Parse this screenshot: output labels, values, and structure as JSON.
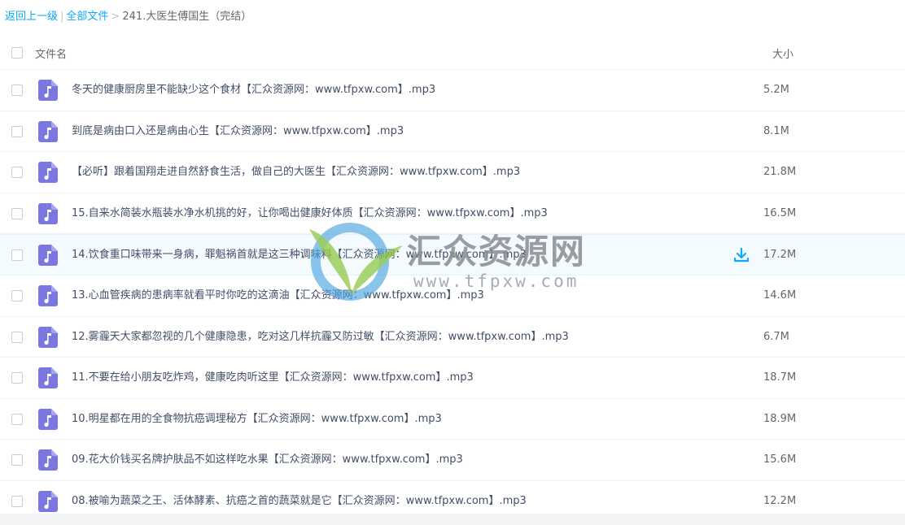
{
  "breadcrumb": {
    "back": "返回上一级",
    "separator": "|",
    "all_files": "全部文件",
    "arrow": ">",
    "current": "241.大医生傅国生（完结）"
  },
  "header": {
    "name_label": "文件名",
    "size_label": "大小"
  },
  "files": [
    {
      "name": "冬天的健康厨房里不能缺少这个食材【汇众资源网：www.tfpxw.com】.mp3",
      "size": "5.2M"
    },
    {
      "name": "到底是病由口入还是病由心生【汇众资源网：www.tfpxw.com】.mp3",
      "size": "8.1M"
    },
    {
      "name": "【必听】跟着国翔走进自然舒食生活，做自己的大医生【汇众资源网：www.tfpxw.com】.mp3",
      "size": "21.8M"
    },
    {
      "name": "15.自来水简装水瓶装水净水机挑的好，让你喝出健康好体质【汇众资源网：www.tfpxw.com】.mp3",
      "size": "16.5M"
    },
    {
      "name": "14.饮食重口味带来一身病，罪魁祸首就是这三种调味料【汇众资源网：www.tfpxw.com】.mp3",
      "size": "17.2M"
    },
    {
      "name": "13.心血管疾病的患病率就看平时你吃的这滴油【汇众资源网：www.tfpxw.com】.mp3",
      "size": "14.6M"
    },
    {
      "name": "12.雾霾天大家都忽视的几个健康隐患，吃对这几样抗霾又防过敏【汇众资源网：www.tfpxw.com】.mp3",
      "size": "6.7M"
    },
    {
      "name": "11.不要在给小朋友吃炸鸡，健康吃肉听这里【汇众资源网：www.tfpxw.com】.mp3",
      "size": "18.7M"
    },
    {
      "name": "10.明星都在用的全食物抗癌调理秘方【汇众资源网：www.tfpxw.com】.mp3",
      "size": "18.9M"
    },
    {
      "name": "09.花大价钱买名牌护肤品不如这样吃水果【汇众资源网：www.tfpxw.com】.mp3",
      "size": "15.6M"
    },
    {
      "name": "08.被喻为蔬菜之王、活体酵素、抗癌之首的蔬菜就是它【汇众资源网：www.tfpxw.com】.mp3",
      "size": "12.2M"
    }
  ],
  "hovered_row": 4,
  "icons": {
    "file": "music-file-icon",
    "download": "download-icon"
  },
  "watermark": {
    "title": "汇众资源网",
    "url": "www.tfpxw.com"
  },
  "colors": {
    "link": "#09aaff",
    "file_icon": "#7b77e0",
    "row_hover": "#f4fbff"
  }
}
